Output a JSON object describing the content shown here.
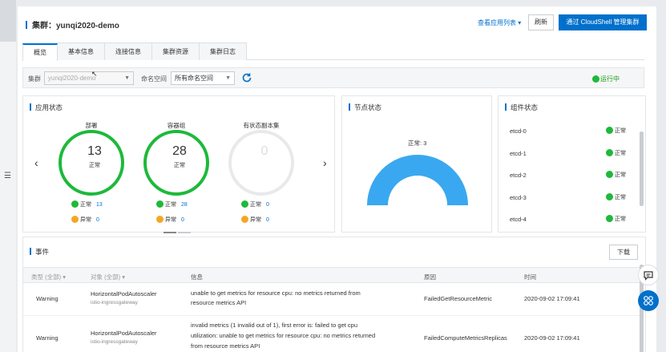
{
  "header": {
    "title": "集群：yunqi2020-demo",
    "view_app_list": "查看应用列表",
    "refresh": "刷新",
    "cloudshell": "通过 CloudShell 管理集群"
  },
  "tabs": [
    {
      "label": "概览",
      "active": true
    },
    {
      "label": "基本信息"
    },
    {
      "label": "连接信息"
    },
    {
      "label": "集群资源"
    },
    {
      "label": "集群日志"
    }
  ],
  "filter": {
    "cluster_label": "集群",
    "cluster_value": "yunqi2020-demo",
    "namespace_label": "命名空间",
    "namespace_value": "所有命名空间",
    "status": "运行中"
  },
  "app_status": {
    "title": "应用状态",
    "workloads": [
      {
        "name": "部署",
        "value": "13",
        "state": "正常",
        "normal_label": "正常",
        "normal": "13",
        "abnormal_label": "异常",
        "abnormal": "0"
      },
      {
        "name": "容器组",
        "value": "28",
        "state": "正常",
        "normal_label": "正常",
        "normal": "28",
        "abnormal_label": "异常",
        "abnormal": "0"
      },
      {
        "name": "有状态副本集",
        "value": "0",
        "state": "",
        "normal_label": "正常",
        "normal": "0",
        "abnormal_label": "异常",
        "abnormal": "0"
      }
    ]
  },
  "node_status": {
    "title": "节点状态",
    "normal_label": "正常: 3"
  },
  "components": {
    "title": "组件状态",
    "items": [
      {
        "name": "etcd-0",
        "status": "正常"
      },
      {
        "name": "etcd-1",
        "status": "正常"
      },
      {
        "name": "etcd-2",
        "status": "正常"
      },
      {
        "name": "etcd-3",
        "status": "正常"
      },
      {
        "name": "etcd-4",
        "status": "正常"
      }
    ]
  },
  "events": {
    "title": "事件",
    "download": "下载",
    "columns": {
      "type": "类型 (全部)",
      "object": "对象 (全部)",
      "message": "信息",
      "reason": "原因",
      "time": "时间"
    },
    "rows": [
      {
        "type": "Warning",
        "object": "HorizontalPodAutoscaler",
        "object_sub": "istio-ingressgateway",
        "message_lines": [
          "unable to get metrics for resource cpu: no metrics returned from",
          "resource metrics API"
        ],
        "reason": "FailedGetResourceMetric",
        "time": "2020-09-02 17:09:41"
      },
      {
        "type": "Warning",
        "object": "HorizontalPodAutoscaler",
        "object_sub": "istio-ingressgateway",
        "message_lines": [
          "invalid metrics (1 invalid out of 1), first error is: failed to get cpu",
          "utilization: unable to get metrics for resource cpu: no metrics returned",
          "from resource metrics API"
        ],
        "reason": "FailedComputeMetricsReplicas",
        "time": "2020-09-02 17:09:41"
      }
    ]
  },
  "colors": {
    "primary": "#0070cc",
    "success": "#1db93a",
    "warning": "#f5a623",
    "gauge": "#3aa8f0"
  }
}
